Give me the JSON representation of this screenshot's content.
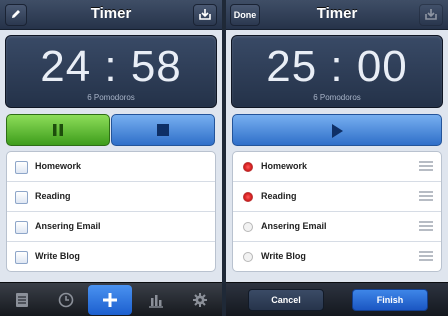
{
  "left_screen": {
    "title": "Timer",
    "timer": {
      "digits": "24 : 58",
      "subtitle": "6 Pomodoros"
    },
    "tasks": [
      {
        "label": "Homework",
        "checked": false
      },
      {
        "label": "Reading",
        "checked": false
      },
      {
        "label": "Ansering Email",
        "checked": false
      },
      {
        "label": "Write Blog",
        "checked": false
      }
    ],
    "tab_icons": [
      "list-icon",
      "clock-icon",
      "plus-icon",
      "bar-chart-icon",
      "gear-icon"
    ],
    "active_tab_index": 2
  },
  "right_screen": {
    "title": "Timer",
    "done_label": "Done",
    "timer": {
      "digits": "25 : 00",
      "subtitle": "6 Pomodoros"
    },
    "tasks": [
      {
        "label": "Homework",
        "selected": true
      },
      {
        "label": "Reading",
        "selected": true
      },
      {
        "label": "Ansering Email",
        "selected": false
      },
      {
        "label": "Write Blog",
        "selected": false
      }
    ],
    "cancel_label": "Cancel",
    "finish_label": "Finish"
  },
  "colors": {
    "pause_green": "#4caf2a",
    "accent_blue": "#2f6fc9",
    "nav_dark": "#26334a",
    "selected_red": "#d62020"
  }
}
